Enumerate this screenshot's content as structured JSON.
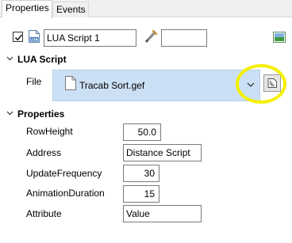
{
  "tabs": [
    {
      "label": "Properties",
      "active": true
    },
    {
      "label": "Events",
      "active": false
    }
  ],
  "header": {
    "enabled": true,
    "name_value": "LUA Script 1",
    "lua_icon_text": "LUA",
    "extra_value": ""
  },
  "lua_section": {
    "title": "LUA Script",
    "file_label": "File",
    "file_name": "Tracab Sort.gef"
  },
  "properties_section": {
    "title": "Properties",
    "rows": [
      {
        "label": "RowHeight",
        "value": "50.0"
      },
      {
        "label": "Address",
        "value": "Distance Script"
      },
      {
        "label": "UpdateFrequency",
        "value": "30"
      },
      {
        "label": "AnimationDuration",
        "value": "15"
      },
      {
        "label": "Attribute",
        "value": "Value"
      }
    ]
  },
  "colors": {
    "selection": "#cce0f5",
    "highlight_ring": "#f4f000"
  }
}
